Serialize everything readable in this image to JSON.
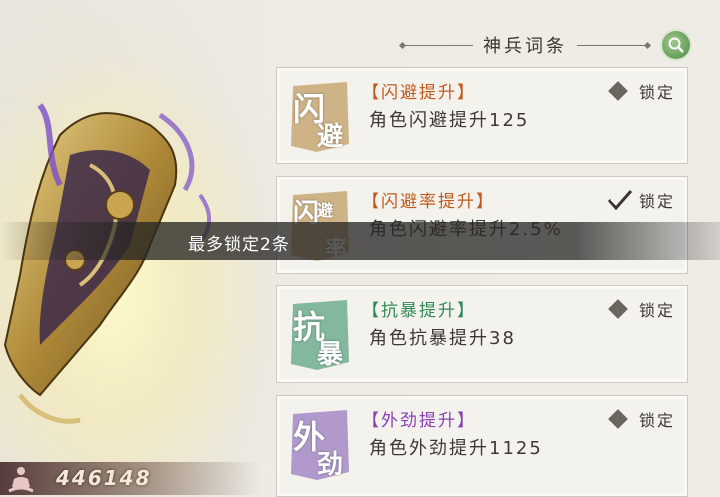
{
  "header": {
    "title": "神兵词条",
    "search_icon": "magnifier-icon"
  },
  "entries": [
    {
      "badge_chars": [
        "闪",
        "避"
      ],
      "badge_color": "#c7a874",
      "title": "【闪避提升】",
      "title_color": "#c15a1c",
      "desc": "角色闪避提升125",
      "lock_label": "锁定",
      "locked": false
    },
    {
      "badge_chars": [
        "闪",
        "避",
        "率"
      ],
      "badge_color": "#c7a874",
      "title": "【闪避率提升】",
      "title_color": "#c15a1c",
      "desc": "角色闪避率提升2.5%",
      "lock_label": "锁定",
      "locked": true
    },
    {
      "badge_chars": [
        "抗",
        "暴"
      ],
      "badge_color": "#6fae8e",
      "title": "【抗暴提升】",
      "title_color": "#2f8a55",
      "desc": "角色抗暴提升38",
      "lock_label": "锁定",
      "locked": false
    },
    {
      "badge_chars": [
        "外",
        "劲"
      ],
      "badge_color": "#a48ac5",
      "title": "【外劲提升】",
      "title_color": "#8a3fb5",
      "desc": "角色外劲提升1125",
      "lock_label": "锁定",
      "locked": false
    }
  ],
  "toast": {
    "text": "最多锁定2条"
  },
  "player": {
    "score": "446148",
    "icon": "meditating-figure-icon"
  }
}
